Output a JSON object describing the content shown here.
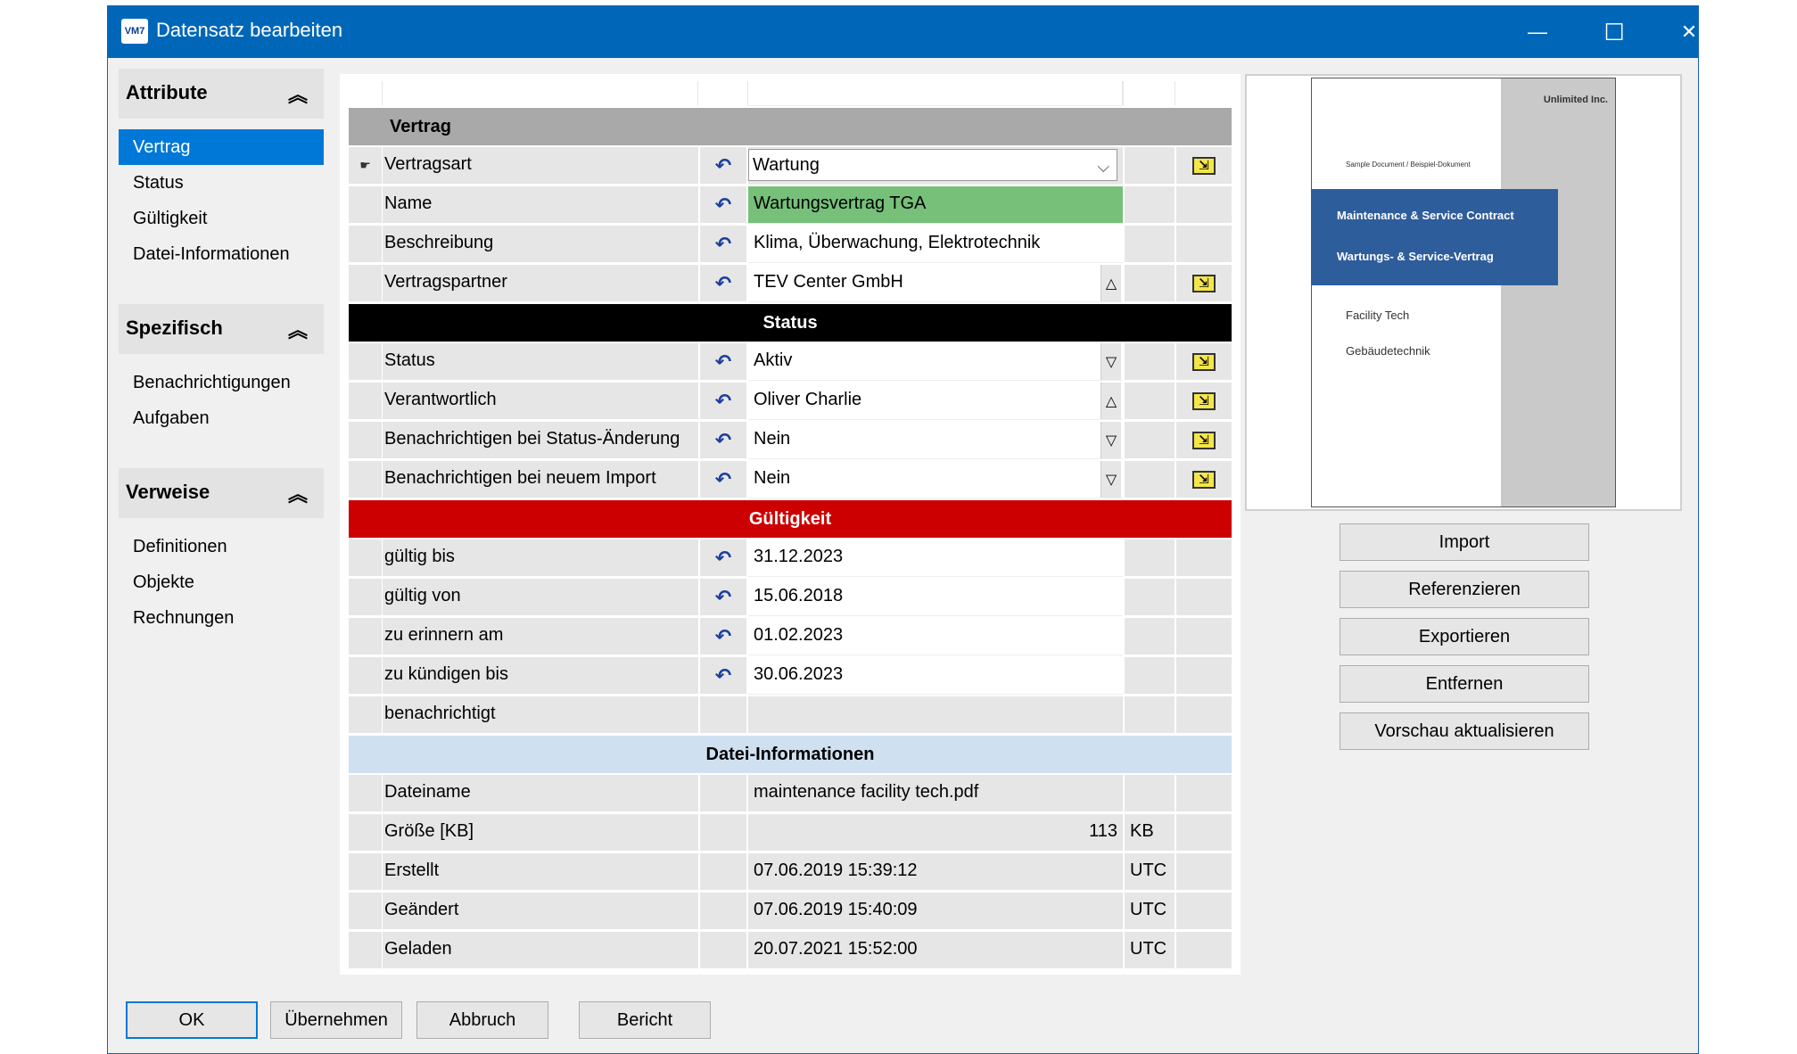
{
  "window": {
    "title": "Datensatz bearbeiten",
    "app_badge": "VM7"
  },
  "titlebar_controls": {
    "minimize": "—",
    "maximize": "☐",
    "close": "✕"
  },
  "sidebar": [
    {
      "header": "Attribute",
      "items": [
        "Vertrag",
        "Status",
        "Gültigkeit",
        "Datei-Informationen"
      ],
      "active": "Vertrag"
    },
    {
      "header": "Spezifisch",
      "items": [
        "Benachrichtigungen",
        "Aufgaben"
      ]
    },
    {
      "header": "Verweise",
      "items": [
        "Definitionen",
        "Objekte",
        "Rechnungen"
      ]
    }
  ],
  "sections": {
    "vertrag": {
      "title": "Vertrag",
      "color": "#a9a9a9"
    },
    "status": {
      "title": "Status",
      "color": "#000000"
    },
    "gueltigkeit": {
      "title": "Gültigkeit",
      "color": "#cc0000"
    },
    "datei": {
      "title": "Datei-Informationen",
      "color": "#cfe0f0"
    }
  },
  "rows": {
    "vertragsart": {
      "label": "Vertragsart",
      "value": "Wartung"
    },
    "name": {
      "label": "Name",
      "value": "Wartungsvertrag TGA"
    },
    "beschreibung": {
      "label": "Beschreibung",
      "value": "Klima, Überwachung, Elektrotechnik"
    },
    "vertragspartner": {
      "label": "Vertragspartner",
      "value": "TEV Center GmbH"
    },
    "status": {
      "label": "Status",
      "value": "Aktiv"
    },
    "verantwortlich": {
      "label": "Verantwortlich",
      "value": "Oliver Charlie"
    },
    "benach_status": {
      "label": "Benachrichtigen bei Status-Änderung",
      "value": "Nein"
    },
    "benach_import": {
      "label": "Benachrichtigen bei neuem Import",
      "value": "Nein"
    },
    "gueltig_bis": {
      "label": "gültig bis",
      "value": "31.12.2023"
    },
    "gueltig_von": {
      "label": "gültig von",
      "value": "15.06.2018"
    },
    "erinnern": {
      "label": "zu erinnern am",
      "value": "01.02.2023"
    },
    "kuendigen": {
      "label": "zu kündigen bis",
      "value": "30.06.2023"
    },
    "benachrichtigt": {
      "label": "benachrichtigt",
      "value": ""
    },
    "dateiname": {
      "label": "Dateiname",
      "value": "maintenance facility tech.pdf"
    },
    "groesse": {
      "label": "Größe [KB]",
      "value": "113",
      "unit": "KB"
    },
    "erstellt": {
      "label": "Erstellt",
      "value": "07.06.2019 15:39:12",
      "unit": "UTC"
    },
    "geaendert": {
      "label": "Geändert",
      "value": "07.06.2019 15:40:09",
      "unit": "UTC"
    },
    "geladen": {
      "label": "Geladen",
      "value": "20.07.2021 15:52:00",
      "unit": "UTC"
    }
  },
  "preview_doc": {
    "logo": "Unlimited Inc.",
    "small_line": "Sample Document / Beispiel-Dokument",
    "band_line1": "Maintenance & Service Contract",
    "band_line2": "Wartungs- & Service-Vertrag",
    "line1": "Facility Tech",
    "line2": "Gebäudetechnik"
  },
  "side_buttons": [
    "Import",
    "Referenzieren",
    "Exportieren",
    "Entfernen",
    "Vorschau aktualisieren"
  ],
  "bottom_buttons": [
    "OK",
    "Übernehmen",
    "Abbruch",
    "Bericht"
  ],
  "icons": {
    "reset": "undo-arrow-icon",
    "action": "yellow-link-icon",
    "collapse": "double-chevron-up-icon"
  }
}
